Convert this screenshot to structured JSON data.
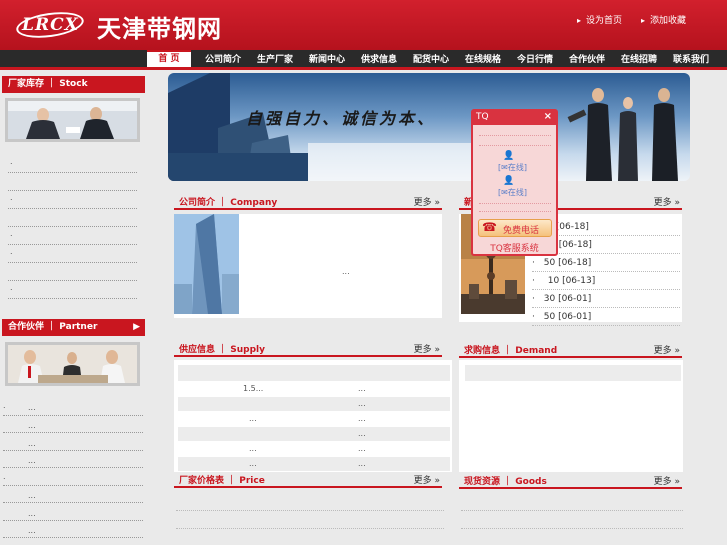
{
  "header": {
    "logo": "LRCX",
    "site_name": "天津带钢网",
    "set_home": "设为首页",
    "add_favorite": "添加收藏"
  },
  "nav": {
    "items": [
      "首 页",
      "公司简介",
      "生产厂家",
      "新闻中心",
      "供求信息",
      "配货中心",
      "在线规格",
      "今日行情",
      "合作伙伴",
      "在线招聘",
      "联系我们"
    ]
  },
  "left": {
    "stock_title": "厂家库存 ｜ Stock",
    "partner_title": "合作伙伴 ｜ Partner",
    "stock_list": [
      ".",
      ".",
      ".",
      ".",
      ".",
      ".",
      ".",
      ".",
      ".",
      "."
    ],
    "partner_list": [
      ".",
      "...",
      "...",
      "...",
      "...",
      ".",
      "...",
      "...",
      "..."
    ]
  },
  "banner": {
    "slogan": "自强自力、诚信为本、"
  },
  "sections": {
    "company": {
      "title": "公司简介 ｜ Company",
      "more": "更多",
      "body": "..."
    },
    "news": {
      "title": "新",
      "more": "更多",
      "items": [
        {
          "text": "",
          "date": "[06-18]"
        },
        {
          "text": "",
          "date": "[06-18]"
        },
        {
          "text": "50",
          "date": "[06-18]"
        },
        {
          "text": "10",
          "date": "[06-13]"
        },
        {
          "text": "30",
          "date": "[06-01]"
        },
        {
          "text": "50",
          "date": "[06-01]"
        }
      ]
    },
    "supply": {
      "title": "供应信息 ｜ Supply",
      "more": "更多",
      "rows": [
        {
          "a": "",
          "b": ""
        },
        {
          "a": "1.5...",
          "b": "..."
        },
        {
          "a": "",
          "b": "..."
        },
        {
          "a": "...",
          "b": "..."
        },
        {
          "a": "",
          "b": "..."
        },
        {
          "a": "...",
          "b": "..."
        },
        {
          "a": "...",
          "b": "..."
        }
      ]
    },
    "demand": {
      "title": "求购信息 ｜ Demand",
      "more": "更多"
    },
    "price": {
      "title": "厂家价格表 ｜ Price",
      "more": "更多"
    },
    "goods": {
      "title": "现货资源 ｜ Goods",
      "more": "更多"
    }
  },
  "tq": {
    "title": "TQ",
    "close": "×",
    "chat_label": "[✉在线]",
    "free_call": "免费电话",
    "footer": "TQ客服系统"
  },
  "colors": {
    "brand_red": "#c9161f",
    "nav_dark": "#2a2a2a"
  }
}
